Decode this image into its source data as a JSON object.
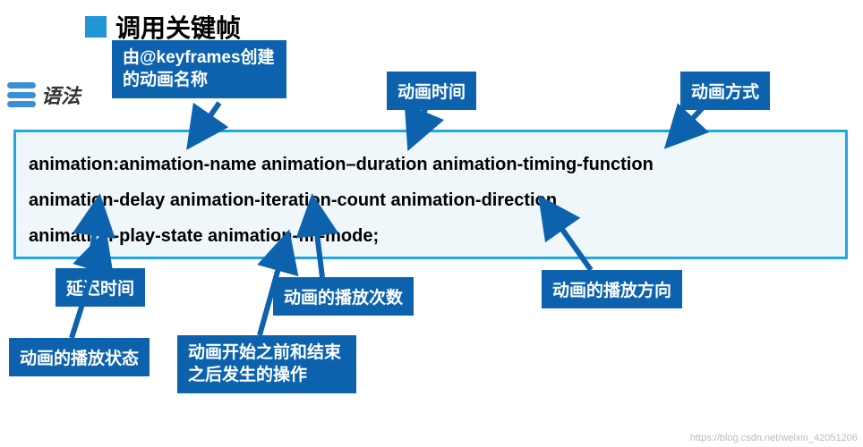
{
  "title": "调用关键帧",
  "syntax_label": "语法",
  "code_line1": "animation:animation-name  animation–duration  animation-timing-function",
  "code_line2": "  animation-delay  animation-iteration-count  animation-direction",
  "code_line3": "animation-play-state  animation-fill-mode;",
  "callouts": {
    "name": "由@keyframes创建的动画名称",
    "duration": "动画时间",
    "timing": "动画方式",
    "delay": "延迟时间",
    "iteration": "动画的播放次数",
    "direction": "动画的播放方向",
    "playstate": "动画的播放状态",
    "fillmode": "动画开始之前和结束之后发生的操作"
  },
  "watermark": "https://blog.csdn.net/weixin_42051206"
}
